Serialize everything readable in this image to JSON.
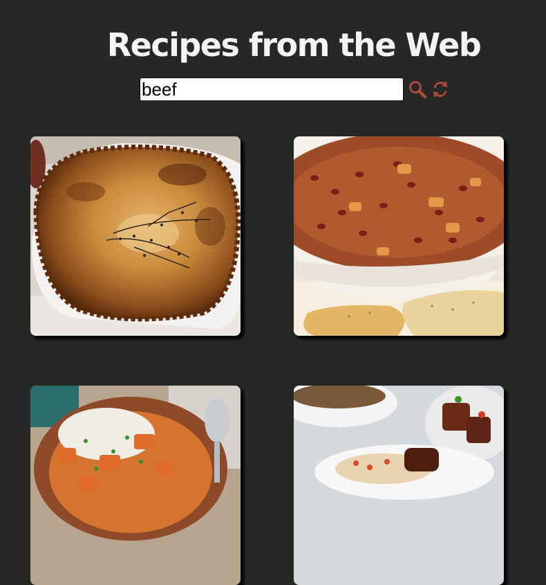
{
  "page": {
    "title": "Recipes from the Web"
  },
  "search": {
    "value": "beef",
    "search_icon": "search-icon",
    "refresh_icon": "refresh-icon"
  },
  "colors": {
    "background": "#262826",
    "accent": "#b0493a",
    "title": "#f3f3f3"
  },
  "recipes": [
    {
      "image": "pot-pie-image"
    },
    {
      "image": "bean-soup-image"
    },
    {
      "image": "beef-stew-with-rice-image"
    },
    {
      "image": "braised-beef-plate-image"
    }
  ]
}
